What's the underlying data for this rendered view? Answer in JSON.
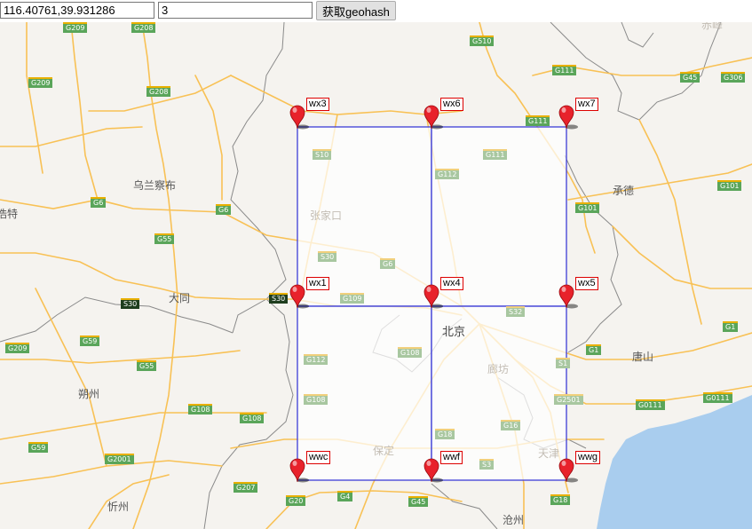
{
  "toolbar": {
    "coordinate_value": "116.40761,39.931286",
    "precision_value": "3",
    "submit_label": "获取geohash"
  },
  "colors": {
    "grid_line": "#3c3cd6",
    "grid_fill": "#ffffff",
    "pin_red": "#e8222b",
    "label_border": "#dd0000",
    "road": "#f8c155",
    "sea": "#a9cdee",
    "land": "#f5f3ef",
    "shield_green": "#5aa55a"
  },
  "geohash_cells": [
    "wx3",
    "wx6",
    "wx7",
    "wx1",
    "wx4",
    "wx5",
    "wwc",
    "wwf",
    "wwg"
  ],
  "grid": {
    "rows": 2,
    "cols": 2
  },
  "cities": [
    {
      "name": "乌兰察布",
      "faded": false
    },
    {
      "name": "浩特",
      "faded": false
    },
    {
      "name": "张家口",
      "faded": true
    },
    {
      "name": "大同",
      "faded": false
    },
    {
      "name": "承德",
      "faded": false
    },
    {
      "name": "北京",
      "faded": false
    },
    {
      "name": "廊坊",
      "faded": true
    },
    {
      "name": "唐山",
      "faded": false
    },
    {
      "name": "朔州",
      "faded": false
    },
    {
      "name": "保定",
      "faded": true
    },
    {
      "name": "天津",
      "faded": true
    },
    {
      "name": "忻州",
      "faded": false
    },
    {
      "name": "沧州",
      "faded": false
    },
    {
      "name": "赤峰",
      "faded": true
    }
  ],
  "road_shields": [
    {
      "label": "G209",
      "kind": "national"
    },
    {
      "label": "G208",
      "kind": "national"
    },
    {
      "label": "G510",
      "kind": "national"
    },
    {
      "label": "G209",
      "kind": "national"
    },
    {
      "label": "G208",
      "kind": "national"
    },
    {
      "label": "G111",
      "kind": "national"
    },
    {
      "label": "G45",
      "kind": "national"
    },
    {
      "label": "G306",
      "kind": "national"
    },
    {
      "label": "G111",
      "kind": "national"
    },
    {
      "label": "S10",
      "kind": "prov"
    },
    {
      "label": "G111",
      "kind": "prov"
    },
    {
      "label": "G112",
      "kind": "prov"
    },
    {
      "label": "G101",
      "kind": "national"
    },
    {
      "label": "G6",
      "kind": "national"
    },
    {
      "label": "G6",
      "kind": "national"
    },
    {
      "label": "G101",
      "kind": "national"
    },
    {
      "label": "G55",
      "kind": "national"
    },
    {
      "label": "S30",
      "kind": "prov"
    },
    {
      "label": "G6",
      "kind": "prov"
    },
    {
      "label": "S30",
      "kind": "black"
    },
    {
      "label": "S30",
      "kind": "black"
    },
    {
      "label": "G109",
      "kind": "prov"
    },
    {
      "label": "S32",
      "kind": "prov"
    },
    {
      "label": "G1",
      "kind": "national"
    },
    {
      "label": "G209",
      "kind": "national"
    },
    {
      "label": "G59",
      "kind": "national"
    },
    {
      "label": "G112",
      "kind": "prov"
    },
    {
      "label": "G108",
      "kind": "prov"
    },
    {
      "label": "S1",
      "kind": "prov"
    },
    {
      "label": "G1",
      "kind": "national"
    },
    {
      "label": "G55",
      "kind": "national"
    },
    {
      "label": "G108",
      "kind": "prov"
    },
    {
      "label": "G2501",
      "kind": "prov"
    },
    {
      "label": "G0111",
      "kind": "national"
    },
    {
      "label": "G0111",
      "kind": "national"
    },
    {
      "label": "G108",
      "kind": "national"
    },
    {
      "label": "G108",
      "kind": "national"
    },
    {
      "label": "G18",
      "kind": "prov"
    },
    {
      "label": "G16",
      "kind": "prov"
    },
    {
      "label": "G59",
      "kind": "national"
    },
    {
      "label": "G2001",
      "kind": "national"
    },
    {
      "label": "S3",
      "kind": "prov"
    },
    {
      "label": "G207",
      "kind": "national"
    },
    {
      "label": "G20",
      "kind": "national"
    },
    {
      "label": "G4",
      "kind": "national"
    },
    {
      "label": "G45",
      "kind": "national"
    },
    {
      "label": "G18",
      "kind": "national"
    }
  ]
}
